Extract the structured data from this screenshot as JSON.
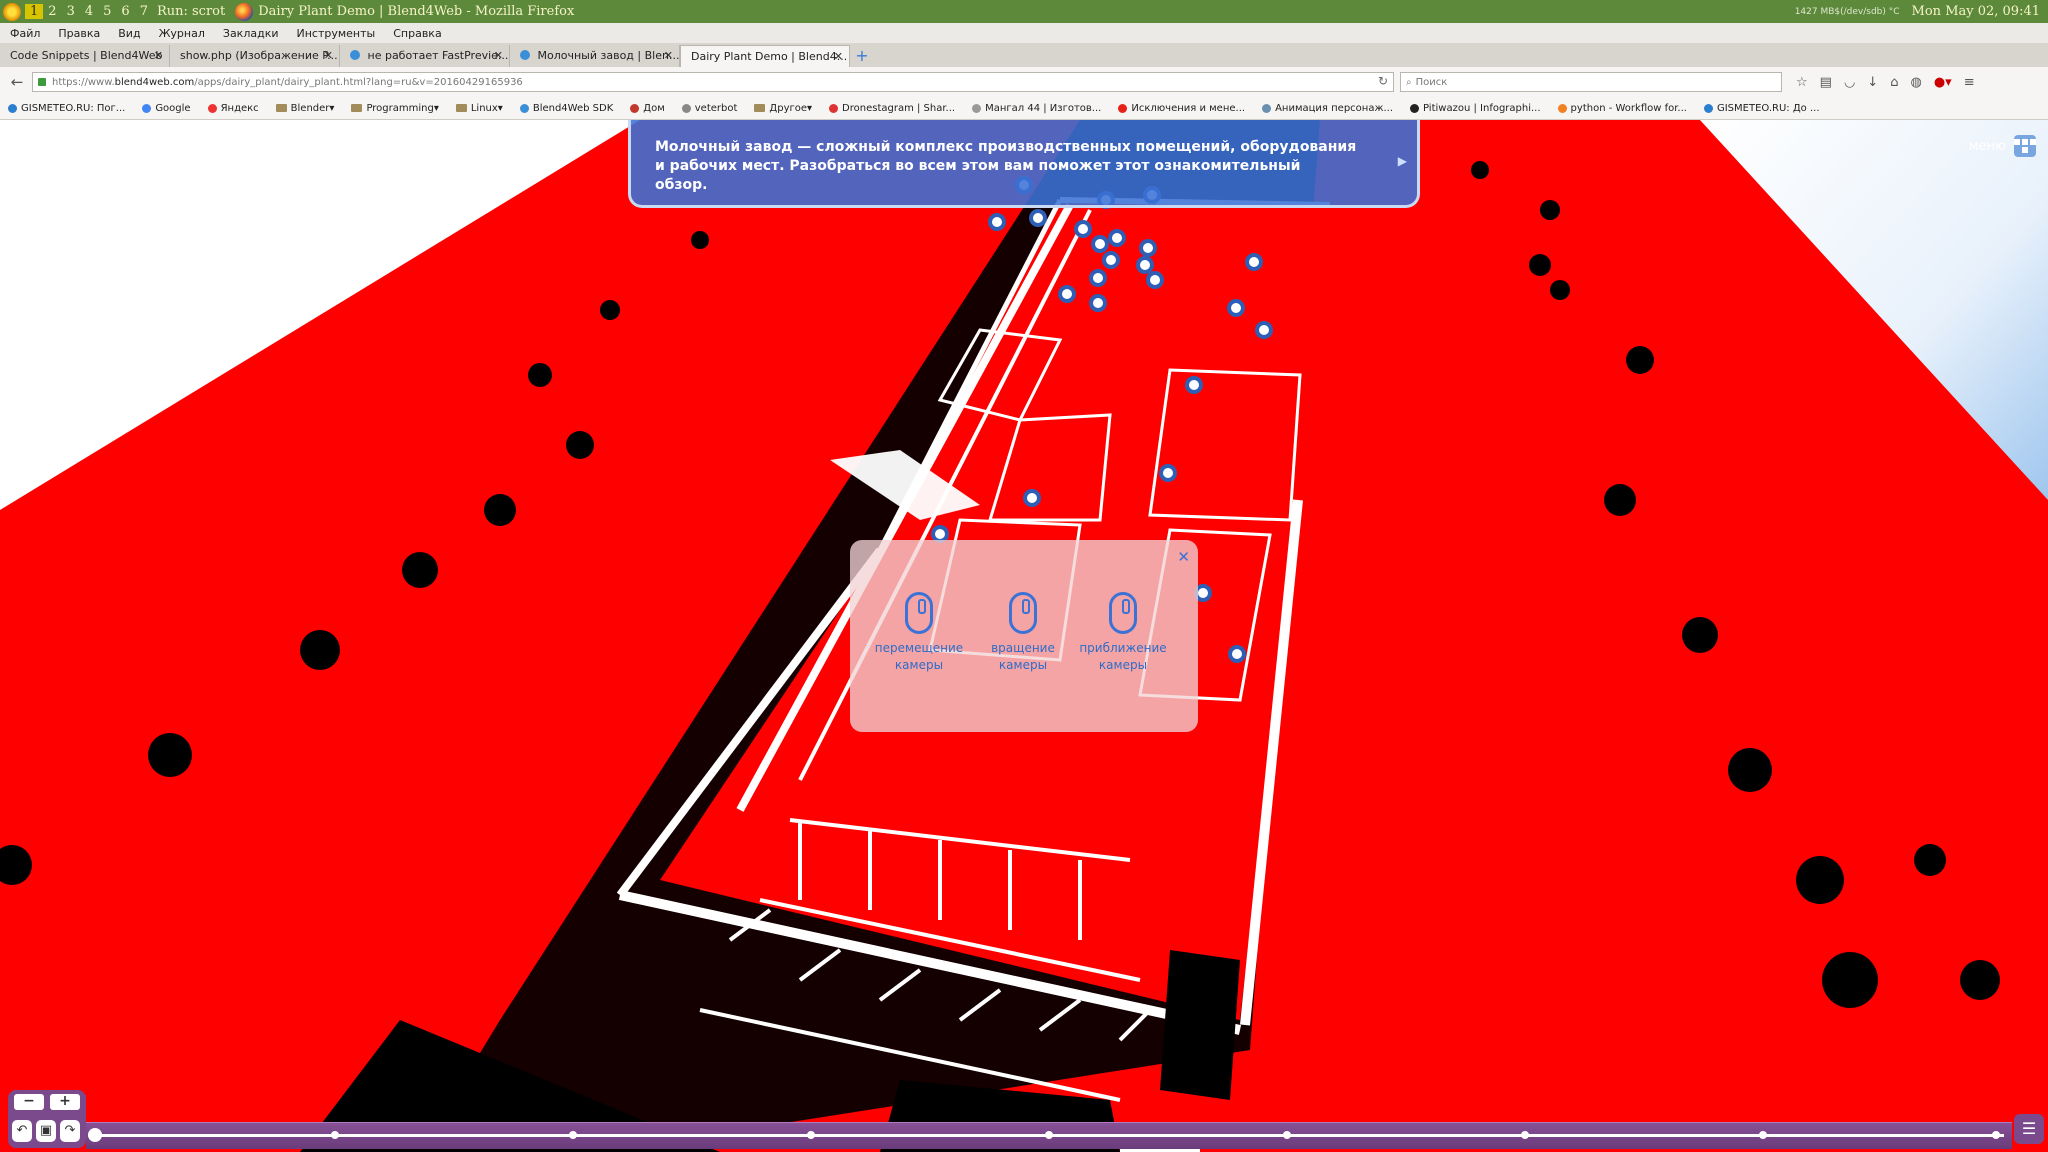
{
  "wm": {
    "workspaces": [
      "1",
      "2",
      "3",
      "4",
      "5",
      "6",
      "7"
    ],
    "active_workspace": "1",
    "run_label": "Run: scrot",
    "window_title": "Dairy Plant Demo | Blend4Web - Mozilla Firefox",
    "disk": "1427 MB$(/dev/sdb) °C",
    "clock": "Mon May 02, 09:41"
  },
  "menu": [
    "Файл",
    "Правка",
    "Вид",
    "Журнал",
    "Закладки",
    "Инструменты",
    "Справка"
  ],
  "tabs": [
    {
      "label": "Code Snippets | Blend4Web"
    },
    {
      "label": "show.php (Изображение P..."
    },
    {
      "label": "не работает FastPrevie..."
    },
    {
      "label": "Молочный завод | Blen..."
    },
    {
      "label": "Dairy Plant Demo | Blend4..."
    }
  ],
  "address": {
    "prefix": "https://www.",
    "domain": "blend4web.com",
    "path": "/apps/dairy_plant/dairy_plant.html?lang=ru&v=20160429165936"
  },
  "search_placeholder": "Поиск",
  "bookmarks": [
    {
      "label": "GISMETEO.RU: Пог..."
    },
    {
      "label": "Google"
    },
    {
      "label": "Яндекс"
    },
    {
      "label": "Blender▾"
    },
    {
      "label": "Programming▾"
    },
    {
      "label": "Linux▾"
    },
    {
      "label": "Blend4Web SDK"
    },
    {
      "label": "Дом"
    },
    {
      "label": "veterbot"
    },
    {
      "label": "Другое▾"
    },
    {
      "label": "Dronestagram | Shar..."
    },
    {
      "label": "Мангал 44 | Изготов..."
    },
    {
      "label": "Исключения и мене..."
    },
    {
      "label": "Анимация персонаж..."
    },
    {
      "label": "Pitiwazou | Infographi..."
    },
    {
      "label": "python - Workflow for..."
    },
    {
      "label": "GISMETEO.RU: До ..."
    }
  ],
  "app": {
    "hint_text": "Молочный завод — сложный комплекс производственных помещений, оборудования и рабочих мест. Разобраться во всем этом вам поможет этот ознакомительный обзор.",
    "menu_label": "меню",
    "help": {
      "move": "перемещение камеры",
      "rotate": "вращение камеры",
      "zoom": "приближение камеры"
    },
    "zoom_minus": "−",
    "zoom_plus": "+"
  },
  "colors": {
    "ground": "#ff0000",
    "accent": "#3a72d6",
    "timeline": "#7a4a8d",
    "wm_bar": "#5d8a3a"
  }
}
